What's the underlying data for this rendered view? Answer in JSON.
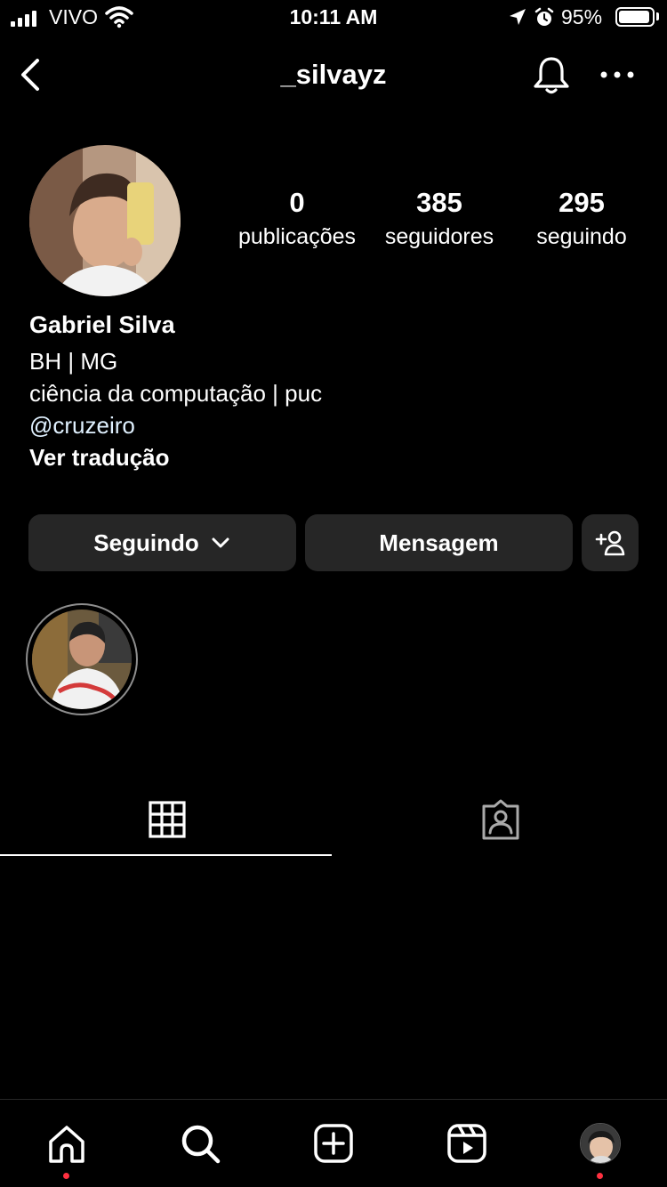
{
  "status_bar": {
    "carrier": "VIVO",
    "time": "10:11 AM",
    "battery_percent": "95%",
    "battery_level": 0.95,
    "icons": [
      "signal-icon",
      "wifi-icon",
      "location-icon",
      "alarm-icon",
      "battery-icon"
    ]
  },
  "header": {
    "username": "_silvayz",
    "icons": [
      "back-icon",
      "bell-icon",
      "more-icon"
    ]
  },
  "profile": {
    "stats": [
      {
        "value": "0",
        "label": "publicações"
      },
      {
        "value": "385",
        "label": "seguidores"
      },
      {
        "value": "295",
        "label": "seguindo"
      }
    ],
    "name": "Gabriel Silva",
    "bio_line1": "BH | MG",
    "bio_line2": "ciência da computação | puc",
    "mention": "@cruzeiro",
    "translate_label": "Ver tradução"
  },
  "actions": {
    "following_label": "Seguindo",
    "message_label": "Mensagem",
    "icons": [
      "chevron-down-icon",
      "add-person-icon"
    ]
  },
  "tabs": {
    "active": "grid",
    "icons": [
      "grid-icon",
      "tagged-icon"
    ]
  },
  "bottom_nav": {
    "items": [
      "home",
      "search",
      "create",
      "reels",
      "profile"
    ],
    "notification_dots": [
      "home",
      "profile"
    ],
    "accent_color": "#ff3040"
  },
  "colors": {
    "background": "#000000",
    "button_bg": "#262626",
    "mention": "#e0f1ff"
  }
}
